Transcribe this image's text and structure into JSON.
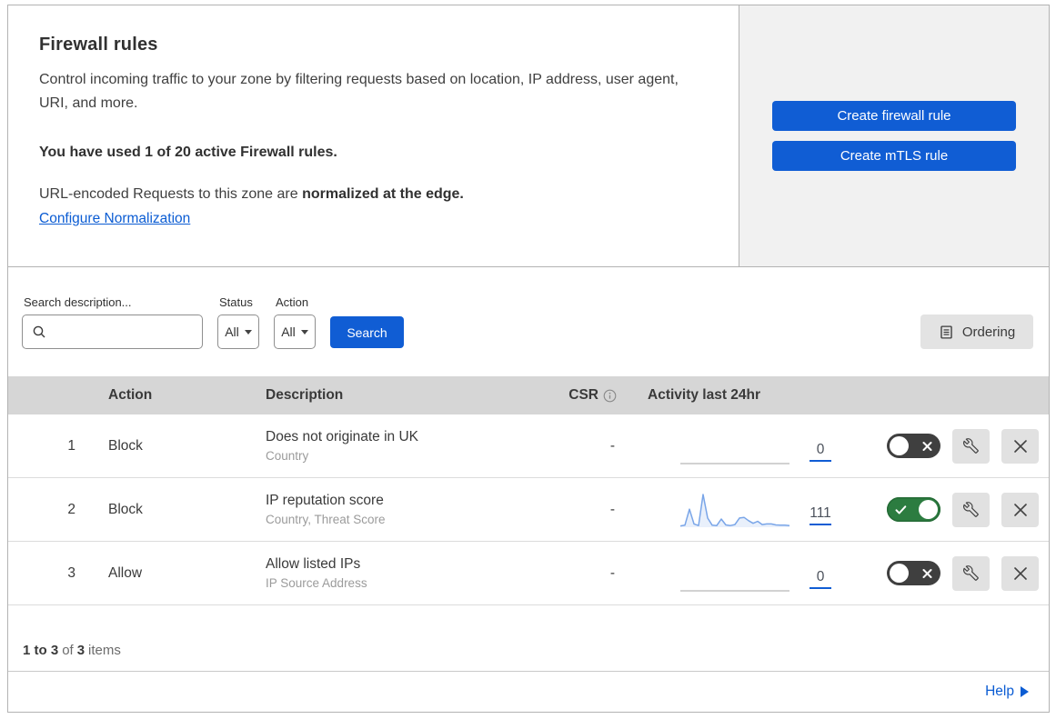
{
  "colors": {
    "primary_blue": "#105dd4",
    "link_blue": "#0b5cd3",
    "toggle_on_green": "#2c7c40",
    "toggle_off_gray": "#3f3f3f",
    "sparkline_blue": "#79a5e8",
    "sparkline_fill": "#e9f0fb",
    "flatline_gray": "#d2d2d2",
    "table_header_bg": "#d6d6d6",
    "side_panel_bg": "#f1f1f1"
  },
  "header": {
    "title": "Firewall rules",
    "description": "Control incoming traffic to your zone by filtering requests based on location, IP address, user agent, URI, and more.",
    "usage_note": "You have used 1 of 20 active Firewall rules.",
    "normalization_text": "URL-encoded Requests to this zone are ",
    "normalization_bold": "normalized at the edge.",
    "normalization_link": "Configure Normalization",
    "buttons": {
      "create_firewall": "Create firewall rule",
      "create_mtls": "Create mTLS rule"
    }
  },
  "filters": {
    "search_label": "Search description...",
    "status_label": "Status",
    "status_value": "All",
    "action_label": "Action",
    "action_value": "All",
    "search_button": "Search",
    "ordering_button": "Ordering"
  },
  "table": {
    "headers": {
      "action": "Action",
      "description": "Description",
      "csr": "CSR",
      "activity": "Activity last 24hr"
    },
    "rows": [
      {
        "priority": "1",
        "action": "Block",
        "description": "Does not originate in UK",
        "match_fields": "Country",
        "csr": "-",
        "activity_count": "0",
        "enabled": false,
        "sparkline": []
      },
      {
        "priority": "2",
        "action": "Block",
        "description": "IP reputation score",
        "match_fields": "Country, Threat Score",
        "csr": "-",
        "activity_count": "111",
        "enabled": true,
        "sparkline": [
          4,
          6,
          55,
          10,
          5,
          100,
          28,
          6,
          5,
          25,
          7,
          5,
          8,
          28,
          30,
          20,
          12,
          18,
          8,
          10,
          10,
          7,
          6,
          6,
          5
        ]
      },
      {
        "priority": "3",
        "action": "Allow",
        "description": "Allow listed IPs",
        "match_fields": "IP Source Address",
        "csr": "-",
        "activity_count": "0",
        "enabled": false,
        "sparkline": []
      }
    ]
  },
  "footer": {
    "range": "1 to 3",
    "of_word": "of",
    "total": "3",
    "items_word": "items",
    "help_label": "Help"
  }
}
